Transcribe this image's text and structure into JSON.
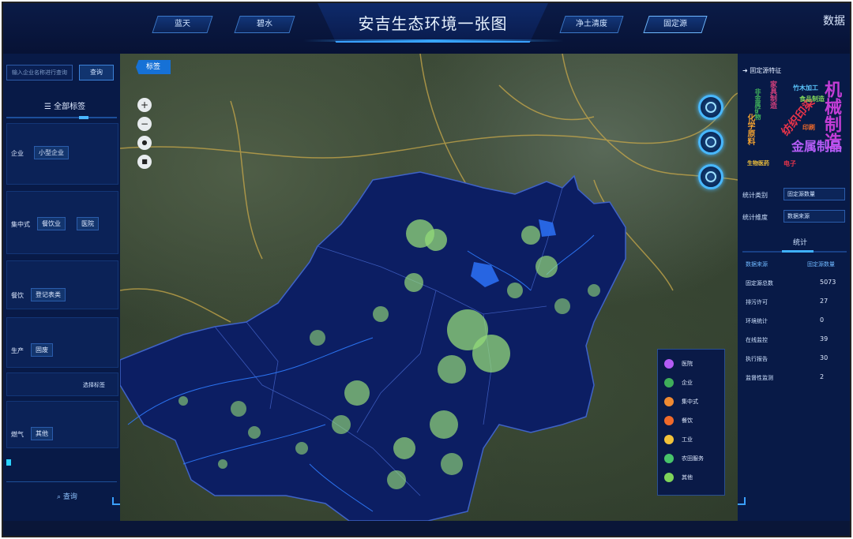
{
  "header": {
    "title": "安吉生态环境一张图",
    "tabs": [
      {
        "label": "蓝天"
      },
      {
        "label": "碧水"
      },
      {
        "label": "净土清废"
      },
      {
        "label": "固定源"
      }
    ],
    "right_text": "数据"
  },
  "left_panel": {
    "search_placeholder": "输入企业名称进行查询",
    "search_button": "查询",
    "all_tags": "全部标签",
    "chips": [
      {
        "label": "企业"
      },
      {
        "label": "小型企业"
      },
      {
        "label": "集中式"
      },
      {
        "label": "餐饮业"
      },
      {
        "label": "医院"
      },
      {
        "label": "餐饮"
      },
      {
        "label": "登记表类"
      },
      {
        "label": "生产"
      },
      {
        "label": "固废"
      },
      {
        "label": "燃气"
      },
      {
        "label": "其他"
      }
    ],
    "side_text": "选择标签",
    "query": "查询"
  },
  "map": {
    "layer_tag": "标签",
    "controls": [
      "+",
      "−",
      "●",
      "■"
    ],
    "legend": [
      {
        "label": "医院",
        "color": "#b45cf5"
      },
      {
        "label": "企业",
        "color": "#3fae5a"
      },
      {
        "label": "集中式",
        "color": "#f08a32"
      },
      {
        "label": "餐饮",
        "color": "#f06a2a"
      },
      {
        "label": "工业",
        "color": "#f2c23a"
      },
      {
        "label": "农田服务",
        "color": "#48c46a"
      },
      {
        "label": "其他",
        "color": "#7fd45a"
      }
    ]
  },
  "right_panel": {
    "title": "固定源特征",
    "wordcloud": [
      {
        "text": "机械制造",
        "color": "#c43dd6"
      },
      {
        "text": "纺织印染",
        "color": "#e8344a"
      },
      {
        "text": "化学原料",
        "color": "#f0a030"
      },
      {
        "text": "非金属矿物",
        "color": "#3fae5a"
      },
      {
        "text": "家具制造",
        "color": "#d5407c"
      },
      {
        "text": "金属制品",
        "color": "#b45cf5"
      },
      {
        "text": "竹木加工",
        "color": "#5cc8ff"
      },
      {
        "text": "生物医药",
        "color": "#f2c23a"
      },
      {
        "text": "食品制造",
        "color": "#7fd45a"
      },
      {
        "text": "印刷",
        "color": "#f06a2a"
      },
      {
        "text": "电子",
        "color": "#e8344a"
      }
    ],
    "filters": [
      {
        "label": "统计类别",
        "value": "固定源数量"
      },
      {
        "label": "统计维度",
        "value": "数据来源"
      }
    ],
    "stat_tab": "统计",
    "stat_headers": [
      "数据来源",
      "固定源数量"
    ],
    "stats": [
      {
        "label": "固定源总数",
        "value": "5073"
      },
      {
        "label": "排污许可",
        "value": "27"
      },
      {
        "label": "环境统计",
        "value": "0"
      },
      {
        "label": "在线监控",
        "value": "39"
      },
      {
        "label": "执行报告",
        "value": "30"
      },
      {
        "label": "监督性监测",
        "value": "2"
      }
    ]
  }
}
